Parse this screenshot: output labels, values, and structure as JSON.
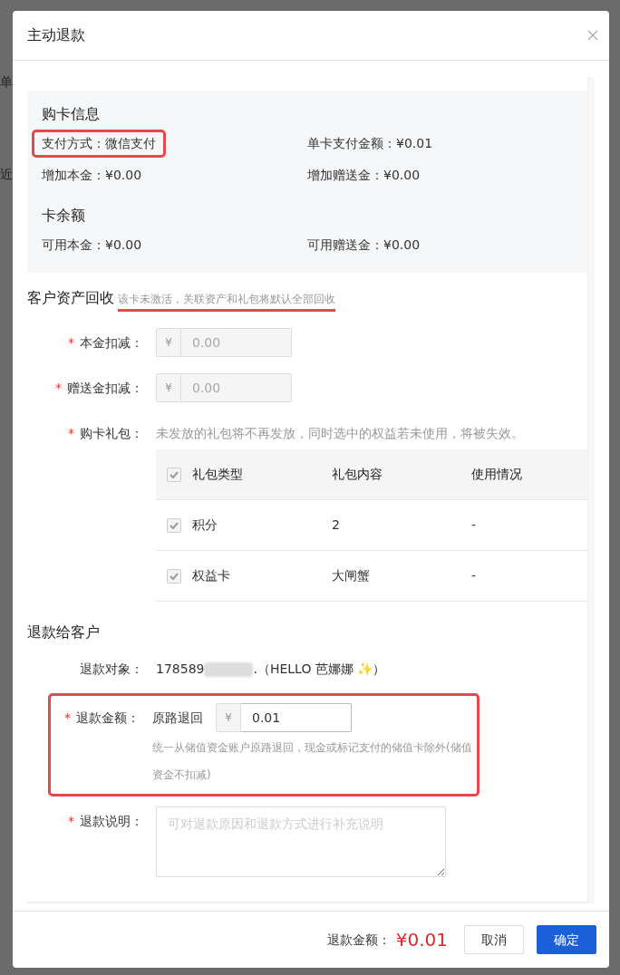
{
  "background_fragments": [
    "单",
    "近"
  ],
  "dialog": {
    "title": "主动退款"
  },
  "card_info": {
    "sections": [
      {
        "title": "购卡信息",
        "fields": [
          {
            "label": "支付方式：",
            "value": "微信支付",
            "annotated": true
          },
          {
            "label": "单卡支付金额：",
            "value": "¥0.01",
            "annotated": false
          },
          {
            "label": "增加本金：",
            "value": "¥0.00",
            "annotated": false
          },
          {
            "label": "增加赠送金：",
            "value": "¥0.00",
            "annotated": false
          }
        ]
      },
      {
        "title": "卡余额",
        "fields": [
          {
            "label": "可用本金：",
            "value": "¥0.00",
            "annotated": false
          },
          {
            "label": "可用赠送金：",
            "value": "¥0.00",
            "annotated": false
          }
        ]
      }
    ]
  },
  "asset_recovery": {
    "title": "客户资产回收",
    "note": "该卡未激活，关联资产和礼包将默认全部回收",
    "note_annotated": true,
    "fields": [
      {
        "kind": "amount",
        "required_mark": "*",
        "label": "本金扣减：",
        "prefix": "¥",
        "placeholder": "0.00",
        "disabled": true
      },
      {
        "kind": "amount",
        "required_mark": "*",
        "label": "赠送金扣减：",
        "prefix": "¥",
        "placeholder": "0.00",
        "disabled": true
      },
      {
        "kind": "packages",
        "required_mark": "*",
        "label": "购卡礼包：",
        "hint": "未发放的礼包将不再发放，同时选中的权益若未使用，将被失效。",
        "table": {
          "all_checked": true,
          "columns": [
            "礼包类型",
            "礼包内容",
            "使用情况"
          ],
          "rows": [
            {
              "checked": true,
              "disabled": true,
              "cells": [
                "积分",
                "2",
                "-"
              ]
            },
            {
              "checked": true,
              "disabled": true,
              "cells": [
                "权益卡",
                "大闸蟹",
                "-"
              ]
            }
          ]
        }
      }
    ]
  },
  "refund": {
    "title": "退款给客户",
    "target": {
      "label": "退款对象：",
      "phone": "178589",
      "name": ".（HELLO 芭娜娜 ✨）"
    },
    "amount": {
      "required_mark": "*",
      "label": "退款金额：",
      "method": "原路退回",
      "prefix": "¥",
      "value": "0.01",
      "help": "统一从储值资金账户原路退回，现金或标记支付的储值卡除外(储值资金不扣减)",
      "annotated": true
    },
    "note": {
      "required_mark": "*",
      "label": "退款说明：",
      "placeholder": "可对退款原因和退款方式进行补充说明"
    }
  },
  "footer": {
    "total_label": "退款金额：",
    "total": "¥0.01",
    "buttons": [
      {
        "label": "取消",
        "kind": "secondary"
      },
      {
        "label": "确定",
        "kind": "primary"
      }
    ]
  }
}
